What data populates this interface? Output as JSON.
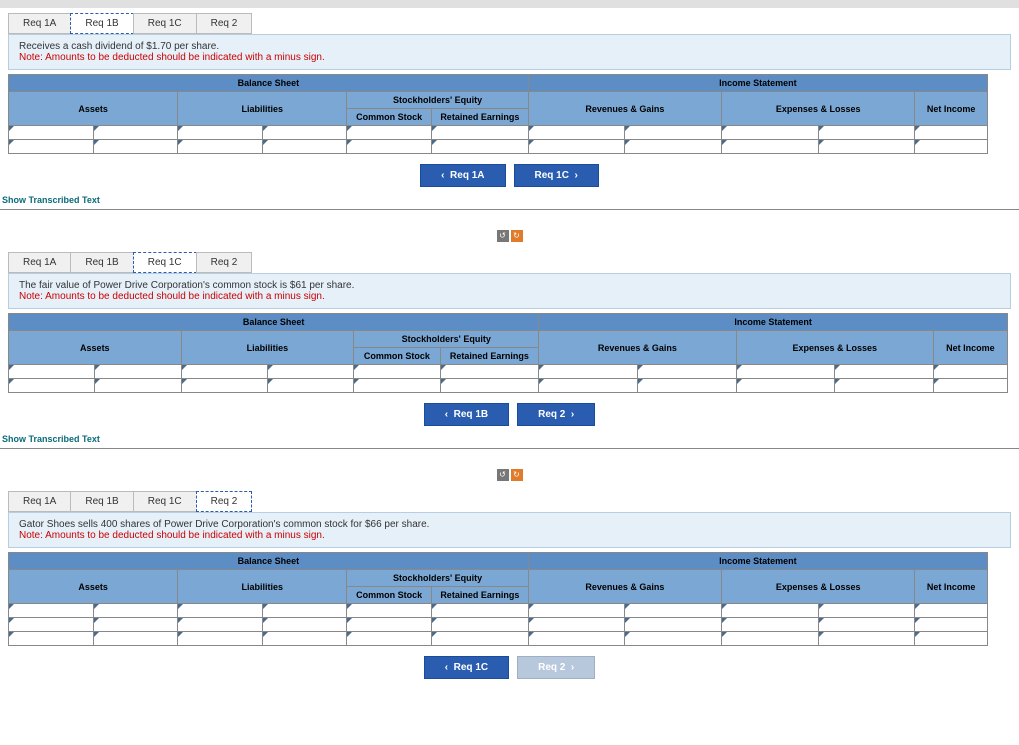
{
  "common": {
    "tabs": [
      "Req 1A",
      "Req 1B",
      "Req 1C",
      "Req 2"
    ],
    "note": "Note: Amounts to be deducted should be indicated with a minus sign.",
    "headers": {
      "balanceSheet": "Balance Sheet",
      "incomeStatement": "Income Statement",
      "assets": "Assets",
      "liabilities": "Liabilities",
      "stockholders": "Stockholders' Equity",
      "commonStock": "Common Stock",
      "retainedEarnings": "Retained Earnings",
      "revenues": "Revenues & Gains",
      "expenses": "Expenses & Losses",
      "netIncome": "Net Income"
    },
    "showLink": "Show Transcribed Text"
  },
  "panels": [
    {
      "activeTab": 1,
      "prompt": "Receives a cash dividend of $1.70 per share.",
      "prevLabel": "Req 1A",
      "nextLabel": "Req 1C",
      "nextDisabled": false,
      "rows": 2,
      "showTopbar": true,
      "wide": false,
      "showLinkAfter": true
    },
    {
      "activeTab": 2,
      "prompt": "The fair value of Power Drive Corporation's common stock is $61 per share.",
      "prevLabel": "Req 1B",
      "nextLabel": "Req 2",
      "nextDisabled": false,
      "rows": 2,
      "showTopbar": false,
      "wide": true,
      "showLinkAfter": true
    },
    {
      "activeTab": 3,
      "prompt": "Gator Shoes sells 400 shares of Power Drive Corporation's common stock for $66 per share.",
      "prevLabel": "Req 1C",
      "nextLabel": "Req 2",
      "nextDisabled": true,
      "rows": 3,
      "showTopbar": false,
      "wide": false,
      "showLinkAfter": false
    }
  ],
  "chart_data": {
    "type": "table",
    "description": "Three accounting worksheet panels (Req 1B, Req 1C, Req 2) each with Balance Sheet (Assets, Liabilities, Common Stock, Retained Earnings) and Income Statement (Revenues & Gains, Expenses & Losses, Net Income) columns. All data cells are empty input fields."
  }
}
